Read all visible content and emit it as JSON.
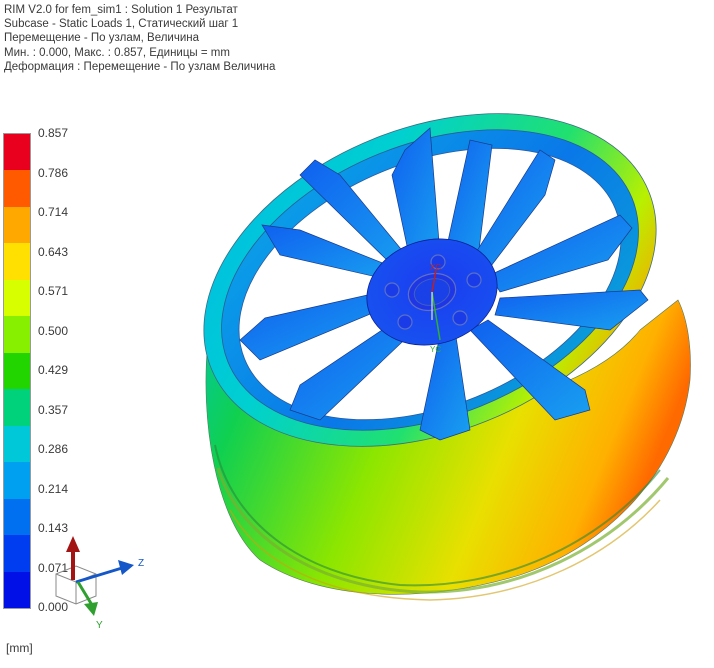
{
  "header": {
    "line1": "RIM V2.0 for fem_sim1 : Solution 1 Результат",
    "line2": "Subcase - Static Loads 1, Статический шаг 1",
    "line3": "Перемещение - По узлам, Величина",
    "line4": "Мин. : 0.000, Макс. : 0.857, Единицы = mm",
    "line5": "Деформация : Перемещение - По узлам Величина"
  },
  "legend": {
    "labels": [
      "0.857",
      "0.786",
      "0.714",
      "0.643",
      "0.571",
      "0.500",
      "0.429",
      "0.357",
      "0.286",
      "0.214",
      "0.143",
      "0.071",
      "0.000"
    ],
    "colors": [
      "#e8001e",
      "#ff5a00",
      "#ffa800",
      "#ffe000",
      "#d8ff00",
      "#86f000",
      "#22d400",
      "#00d27c",
      "#00c8d8",
      "#00a0f0",
      "#0070f0",
      "#003cf0",
      "#0010e6"
    ],
    "unit": "[mm]"
  },
  "model": {
    "triad_labels": {
      "y_up": "YC",
      "x": "XC"
    }
  },
  "triad": {
    "z_label": "Z",
    "y_label": "Y",
    "colors": {
      "x": "#a31515",
      "y": "#2fa02f",
      "z": "#1457c8"
    }
  }
}
